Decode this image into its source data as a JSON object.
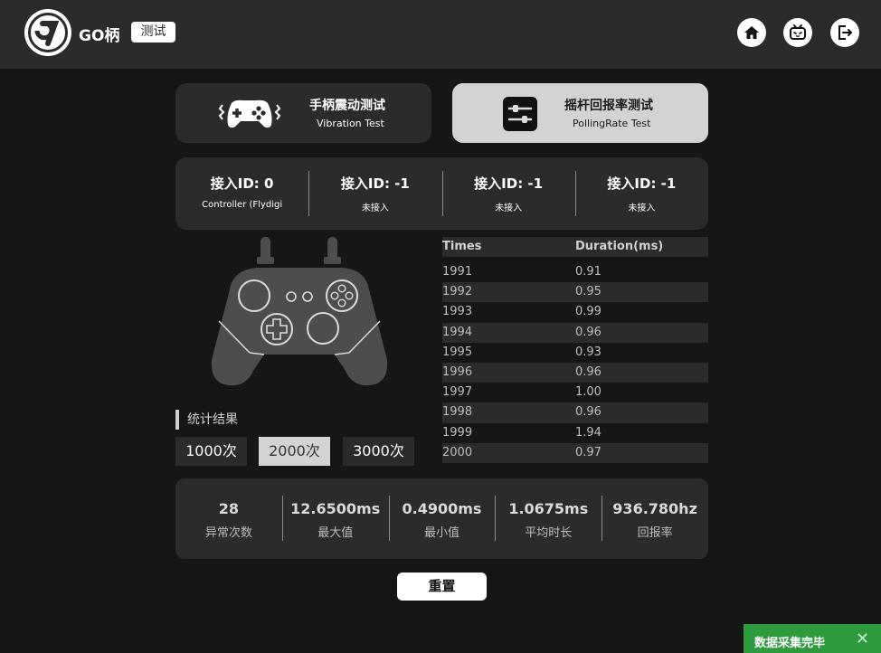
{
  "header": {
    "brand": "GO柄",
    "mode_badge": "测试",
    "icons": [
      "home-icon",
      "bilibili-tv-icon",
      "exit-icon"
    ]
  },
  "modes": [
    {
      "title": "手柄震动测试",
      "subtitle": "Vibration Test",
      "icon": "gamepad-vibration-icon",
      "selected": false
    },
    {
      "title": "摇杆回报率测试",
      "subtitle": "PollingRate Test",
      "icon": "sliders-icon",
      "selected": true
    }
  ],
  "controllers": [
    {
      "id_label": "接入ID: 0",
      "status": "Controller (Flydigi"
    },
    {
      "id_label": "接入ID: -1",
      "status": "未接入"
    },
    {
      "id_label": "接入ID: -1",
      "status": "未接入"
    },
    {
      "id_label": "接入ID: -1",
      "status": "未接入"
    }
  ],
  "stats": {
    "label": "统计结果",
    "count_options": [
      "1000次",
      "2000次",
      "3000次"
    ],
    "selected_count": "2000次"
  },
  "table": {
    "headers": [
      "Times",
      "Duration(ms)"
    ],
    "rows": [
      [
        "1991",
        "0.91"
      ],
      [
        "1992",
        "0.95"
      ],
      [
        "1993",
        "0.99"
      ],
      [
        "1994",
        "0.96"
      ],
      [
        "1995",
        "0.93"
      ],
      [
        "1996",
        "0.96"
      ],
      [
        "1997",
        "1.00"
      ],
      [
        "1998",
        "0.96"
      ],
      [
        "1999",
        "1.94"
      ],
      [
        "2000",
        "0.97"
      ]
    ]
  },
  "summary": [
    {
      "value": "28",
      "label": "异常次数"
    },
    {
      "value": "12.6500ms",
      "label": "最大值"
    },
    {
      "value": "0.4900ms",
      "label": "最小值"
    },
    {
      "value": "1.0675ms",
      "label": "平均时长"
    },
    {
      "value": "936.780hz",
      "label": "回报率"
    }
  ],
  "reset_label": "重置",
  "toast": {
    "text": "数据采集完毕",
    "close": "✕",
    "color": "#2e9a3e"
  },
  "colors": {
    "background": "#161616",
    "panel": "#2b2b2b",
    "selected": "#d3d3d3"
  }
}
